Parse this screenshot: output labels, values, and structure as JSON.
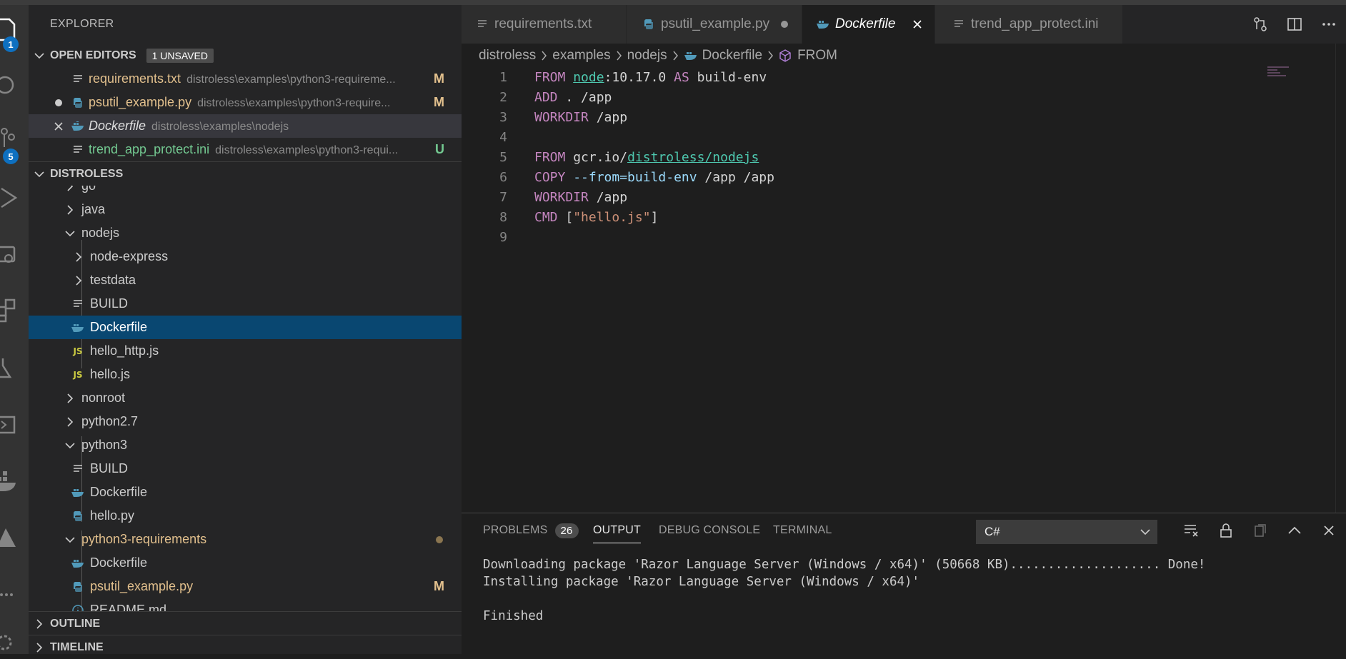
{
  "activity": {
    "explorer_badge": "1",
    "scm_badge": "5"
  },
  "sidebar": {
    "title": "EXPLORER",
    "open_editors": {
      "header": "OPEN EDITORS",
      "badge": "1 UNSAVED",
      "items": [
        {
          "name": "requirements.txt",
          "path": "distroless\\examples\\python3-requireme...",
          "status": "M"
        },
        {
          "name": "psutil_example.py",
          "path": "distroless\\examples\\python3-require...",
          "status": "M"
        },
        {
          "name": "Dockerfile",
          "path": "distroless\\examples\\nodejs",
          "status": ""
        },
        {
          "name": "trend_app_protect.ini",
          "path": "distroless\\examples\\python3-requi...",
          "status": "U"
        }
      ]
    },
    "folder": {
      "header": "DISTROLESS",
      "items": [
        {
          "label": "go"
        },
        {
          "label": "java"
        },
        {
          "label": "nodejs"
        },
        {
          "label": "node-express"
        },
        {
          "label": "testdata"
        },
        {
          "label": "BUILD"
        },
        {
          "label": "Dockerfile"
        },
        {
          "label": "hello_http.js"
        },
        {
          "label": "hello.js"
        },
        {
          "label": "nonroot"
        },
        {
          "label": "python2.7"
        },
        {
          "label": "python3"
        },
        {
          "label": "BUILD"
        },
        {
          "label": "Dockerfile"
        },
        {
          "label": "hello.py"
        },
        {
          "label": "python3-requirements"
        },
        {
          "label": "Dockerfile"
        },
        {
          "label": "psutil_example.py",
          "status": "M"
        },
        {
          "label": "README.md"
        }
      ]
    },
    "outline": "OUTLINE",
    "timeline": "TIMELINE"
  },
  "tabs": [
    {
      "label": "requirements.txt"
    },
    {
      "label": "psutil_example.py"
    },
    {
      "label": "Dockerfile"
    },
    {
      "label": "trend_app_protect.ini"
    }
  ],
  "breadcrumb": [
    "distroless",
    "examples",
    "nodejs",
    "Dockerfile",
    "FROM"
  ],
  "code": {
    "line_numbers": [
      "1",
      "2",
      "3",
      "4",
      "5",
      "6",
      "7",
      "8",
      "9"
    ],
    "l1": {
      "kw": "FROM",
      "img": "node",
      "rest": ":10.17.0 ",
      "kw2": "AS",
      "rest2": " build-env"
    },
    "l2": {
      "kw": "ADD",
      "rest": " . /app"
    },
    "l3": {
      "kw": "WORKDIR",
      "rest": " /app"
    },
    "l5": {
      "kw": "FROM",
      "pre": " gcr.io/",
      "img": "distroless/nodejs"
    },
    "l6": {
      "kw": "COPY",
      "flag": " --from=build-env",
      "rest": " /app /app"
    },
    "l7": {
      "kw": "WORKDIR",
      "rest": " /app"
    },
    "l8": {
      "kw": "CMD",
      "pre": " [",
      "str": "\"hello.js\"",
      "post": "]"
    }
  },
  "panel": {
    "tabs": {
      "problems": "PROBLEMS",
      "problems_count": "26",
      "output": "OUTPUT",
      "debug": "DEBUG CONSOLE",
      "terminal": "TERMINAL"
    },
    "channel": "C#",
    "output_lines": [
      "Downloading package 'Razor Language Server (Windows / x64)' (50668 KB).................... Done!",
      "Installing package 'Razor Language Server (Windows / x64)'",
      "",
      "Finished"
    ]
  }
}
